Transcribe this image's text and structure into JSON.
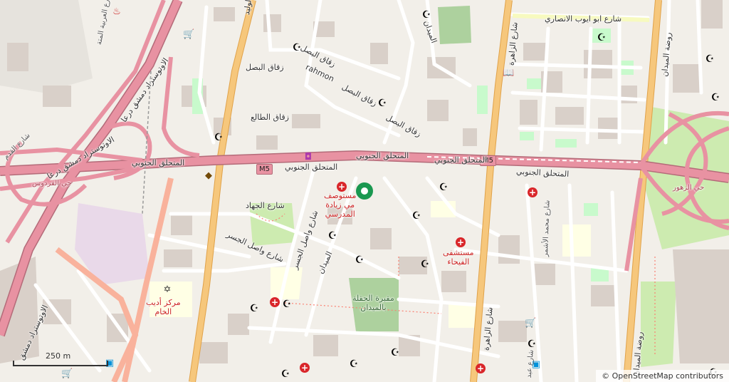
{
  "map": {
    "colors": {
      "background": "#f2efe9",
      "motorway": "#e892a2",
      "motorway_casing": "#b46b79",
      "trunk": "#f9b29c",
      "primary": "#f6c77c",
      "park": "#cdebb0",
      "grass": "#c8facc",
      "building": "#d9d0c9",
      "military": "#e9d9e9",
      "school": "#ffffe5"
    },
    "shields": {
      "m5_west": "M5",
      "m5_east": "M5"
    },
    "labels": {
      "street_abu_ayyub": "شارع ابو ايوب الانصاري",
      "khaled_ibn_walid": "شارع خالد ابن الوليد",
      "zuqaq_asal_1": "زقاق البصل",
      "zuqaq_asal_2": "زقاق البصل",
      "zuqaq_asal_3": "زقاق البصل",
      "zuqaq_asal_4": "زقاق البصل",
      "rahmon": "rahmon",
      "zuqaq_taleh": "زقاق الطالع",
      "midan_north": "الميدان",
      "zahra_north": "شارع الزاهرة",
      "rawda_midan_north": "روضة الميدان",
      "mutahalliq_1": "المتحلق الجنوبي",
      "mutahalliq_2": "المتحلق الجنوبي",
      "mutahalliq_3": "المتحلق الجنوبي",
      "mutahalliq_4": "المتحلق الجنوبي",
      "mutahalliq_5": "المتحلق الجنوبي",
      "autostrad_1": "الاوتوستراد دمشق درعا",
      "autostrad_2": "الاوتوستراد دمشق درعا",
      "autostrad_3": "الاوتوستراد دمشق",
      "arabiya": "شارع العربية المتة",
      "qadam": "شارع القدم",
      "firdous": "حي الفردوس",
      "zuhour": "حي الزهور",
      "jihad": "شارع الجهاد",
      "wasel_jisr": "شارع واصل الجسر",
      "wasel_jisr_2": "شارع واصل الجسر",
      "midan_south": "الميدان",
      "zahra_south": "شارع الزاهرة",
      "muhammad_ashmar": "شارع محمد الأشمر",
      "rawda_midan_south": "روضة الميدان",
      "hospital_zaida": "مستوصف\nمي زيادة\nالمدرسي",
      "hospital_fayhaa": "مستشفى\nالفيحاء",
      "markaz_adib": "مركز أديب\nالخام",
      "maqbara": "مقبرة الحقلة\nبالميدان",
      "abdullah": "شارع عبد"
    },
    "scale": {
      "text": "250 m"
    },
    "attribution": "© OpenStreetMap contributors",
    "icons": [
      "mosque-icon",
      "hospital-icon",
      "synagogue-icon",
      "shop-icon",
      "library-icon",
      "bus-stop-icon",
      "location-marker-icon"
    ]
  }
}
